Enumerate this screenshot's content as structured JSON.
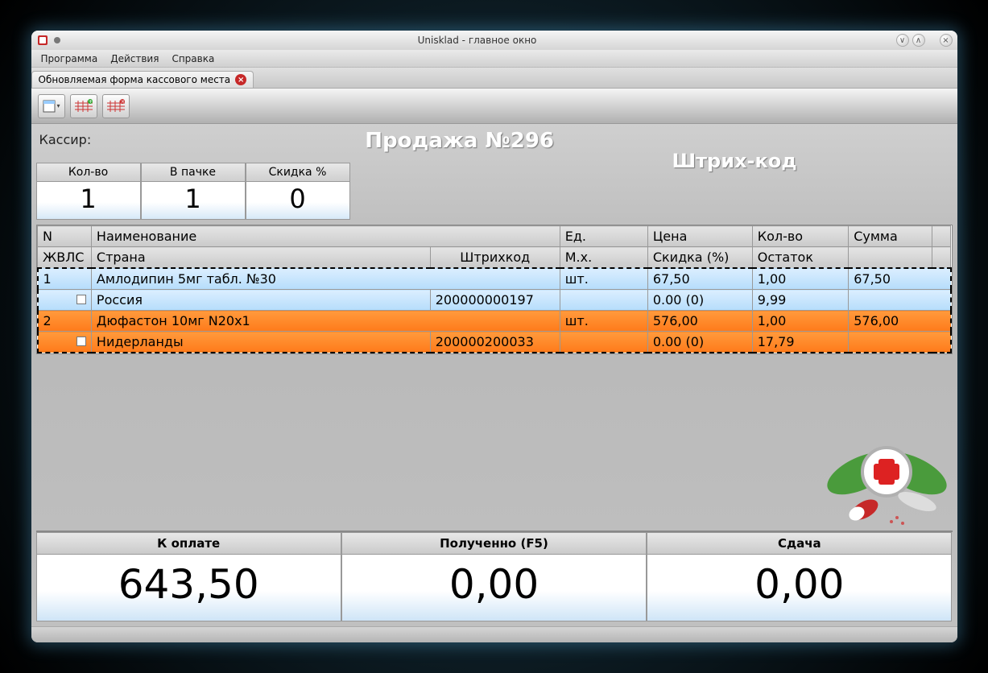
{
  "window": {
    "title": "Unisklad - главное окно"
  },
  "menubar": {
    "items": [
      "Программа",
      "Действия",
      "Справка"
    ]
  },
  "tab": {
    "label": "Обновляемая форма кассового места"
  },
  "cashier_label": "Кассир:",
  "sale_title": "Продажа №296",
  "barcode_label": "Штрих-код",
  "qty_panel": {
    "headers": [
      "Кол-во",
      "В пачке",
      "Скидка %"
    ],
    "values": [
      "1",
      "1",
      "0"
    ]
  },
  "grid": {
    "header_row1": {
      "n": "N",
      "name": "Наименование",
      "unit": "Ед.",
      "price": "Цена",
      "qty": "Кол-во",
      "sum": "Сумма"
    },
    "header_row2": {
      "zh": "ЖВЛС",
      "country": "Страна",
      "barcode": "Штрихкод",
      "mx": "М.х.",
      "discount": "Скидка (%)",
      "remain": "Остаток"
    },
    "rows": [
      {
        "n": "1",
        "name": "Амлодипин 5мг табл. №30",
        "unit": "шт.",
        "price": "67,50",
        "qty": "1,00",
        "sum": "67,50",
        "country": "Россия",
        "barcode": "200000000197",
        "mx": "",
        "discount": "0.00 (0)",
        "remain": "9,99"
      },
      {
        "n": "2",
        "name": "Дюфастон  10мг N20х1",
        "unit": "шт.",
        "price": "576,00",
        "qty": "1,00",
        "sum": "576,00",
        "country": "Нидерланды",
        "barcode": "200000200033",
        "mx": "",
        "discount": "0.00 (0)",
        "remain": "17,79"
      }
    ]
  },
  "totals": {
    "labels": [
      "К оплате",
      "Полученно (F5)",
      "Сдача"
    ],
    "values": [
      "643,50",
      "0,00",
      "0,00"
    ]
  }
}
